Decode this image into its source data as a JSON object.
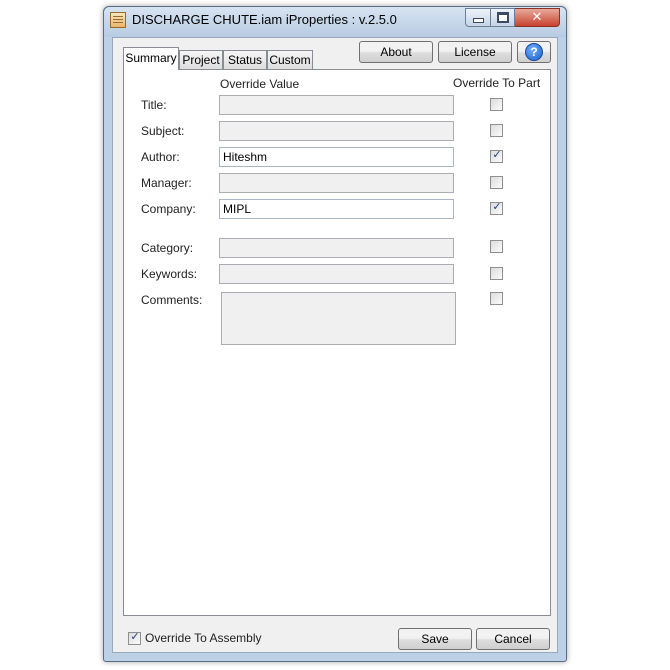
{
  "window": {
    "title": "DISCHARGE CHUTE.iam iProperties : v.2.5.0",
    "icon": "iproperties-app-icon",
    "controls": {
      "minimize": "minimize-icon",
      "maximize": "maximize-icon",
      "close": "close-icon"
    }
  },
  "tabs": [
    {
      "label": "Summary",
      "active": true
    },
    {
      "label": "Project",
      "active": false
    },
    {
      "label": "Status",
      "active": false
    },
    {
      "label": "Custom",
      "active": false
    }
  ],
  "buttons": {
    "about": "About",
    "license": "License",
    "help": "?",
    "save": "Save",
    "cancel": "Cancel"
  },
  "columns": {
    "override_value": "Override Value",
    "override_to_part": "Override To Part"
  },
  "fields": [
    {
      "label": "Title:",
      "value": "",
      "enabled": false,
      "override": false
    },
    {
      "label": "Subject:",
      "value": "",
      "enabled": false,
      "override": false
    },
    {
      "label": "Author:",
      "value": "Hiteshm",
      "enabled": true,
      "override": true
    },
    {
      "label": "Manager:",
      "value": "",
      "enabled": false,
      "override": false
    },
    {
      "label": "Company:",
      "value": "MIPL",
      "enabled": true,
      "override": true
    },
    {
      "label": "Category:",
      "value": "",
      "enabled": false,
      "override": false
    },
    {
      "label": "Keywords:",
      "value": "",
      "enabled": false,
      "override": false
    },
    {
      "label": "Comments:",
      "value": "",
      "enabled": false,
      "override": false
    }
  ],
  "footer": {
    "override_to_assembly": "Override To Assembly",
    "override_to_assembly_checked": true
  },
  "colors": {
    "title_bar": "#c4d5ea",
    "close_button": "#c7432e",
    "panel": "#ffffff",
    "client": "#f0f0f0",
    "checkmark": "#1f3f7a"
  }
}
